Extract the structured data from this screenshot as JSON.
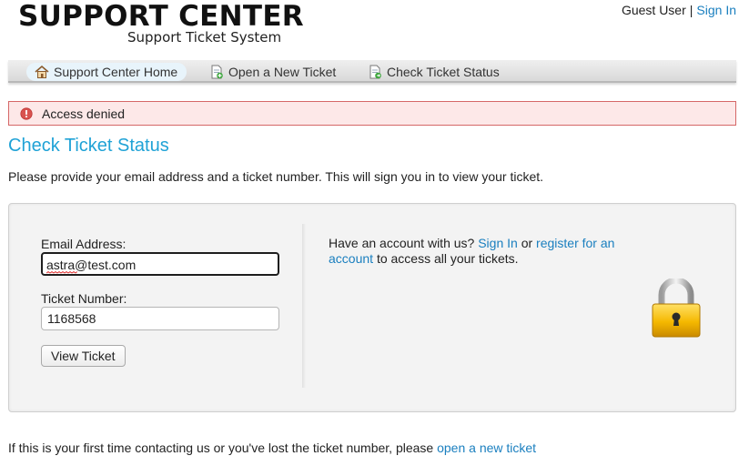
{
  "header": {
    "logo_title": "SUPPORT CENTER",
    "logo_subtitle": "Support Ticket System",
    "user_name": "Guest User",
    "separator": "|",
    "sign_in_link": "Sign In"
  },
  "nav": {
    "items": [
      {
        "label": "Support Center Home",
        "icon": "home-icon",
        "active": true
      },
      {
        "label": "Open a New Ticket",
        "icon": "new-ticket-icon",
        "active": false
      },
      {
        "label": "Check Ticket Status",
        "icon": "ticket-status-icon",
        "active": false
      }
    ]
  },
  "alert": {
    "message": "Access denied",
    "icon": "error-icon",
    "color": "#d56767"
  },
  "page": {
    "title": "Check Ticket Status",
    "intro": "Please provide your email address and a ticket number. This will sign you in to view your ticket."
  },
  "form": {
    "email_label": "Email Address:",
    "email_value": "astra@test.com",
    "ticket_label": "Ticket Number:",
    "ticket_value": "1168568",
    "submit_label": "View Ticket"
  },
  "account": {
    "prefix": "Have an account with us?",
    "sign_in_link": "Sign In",
    "or": "or",
    "register_link": "register for an account",
    "suffix": "to access all your tickets.",
    "icon": "lock-icon"
  },
  "footer": {
    "text": "If this is your first time contacting us or you've lost the ticket number, please",
    "link": "open a new ticket"
  },
  "colors": {
    "accent": "#1fa2d6",
    "link": "#1a7fbf",
    "alert_bg": "#fde8e8"
  }
}
